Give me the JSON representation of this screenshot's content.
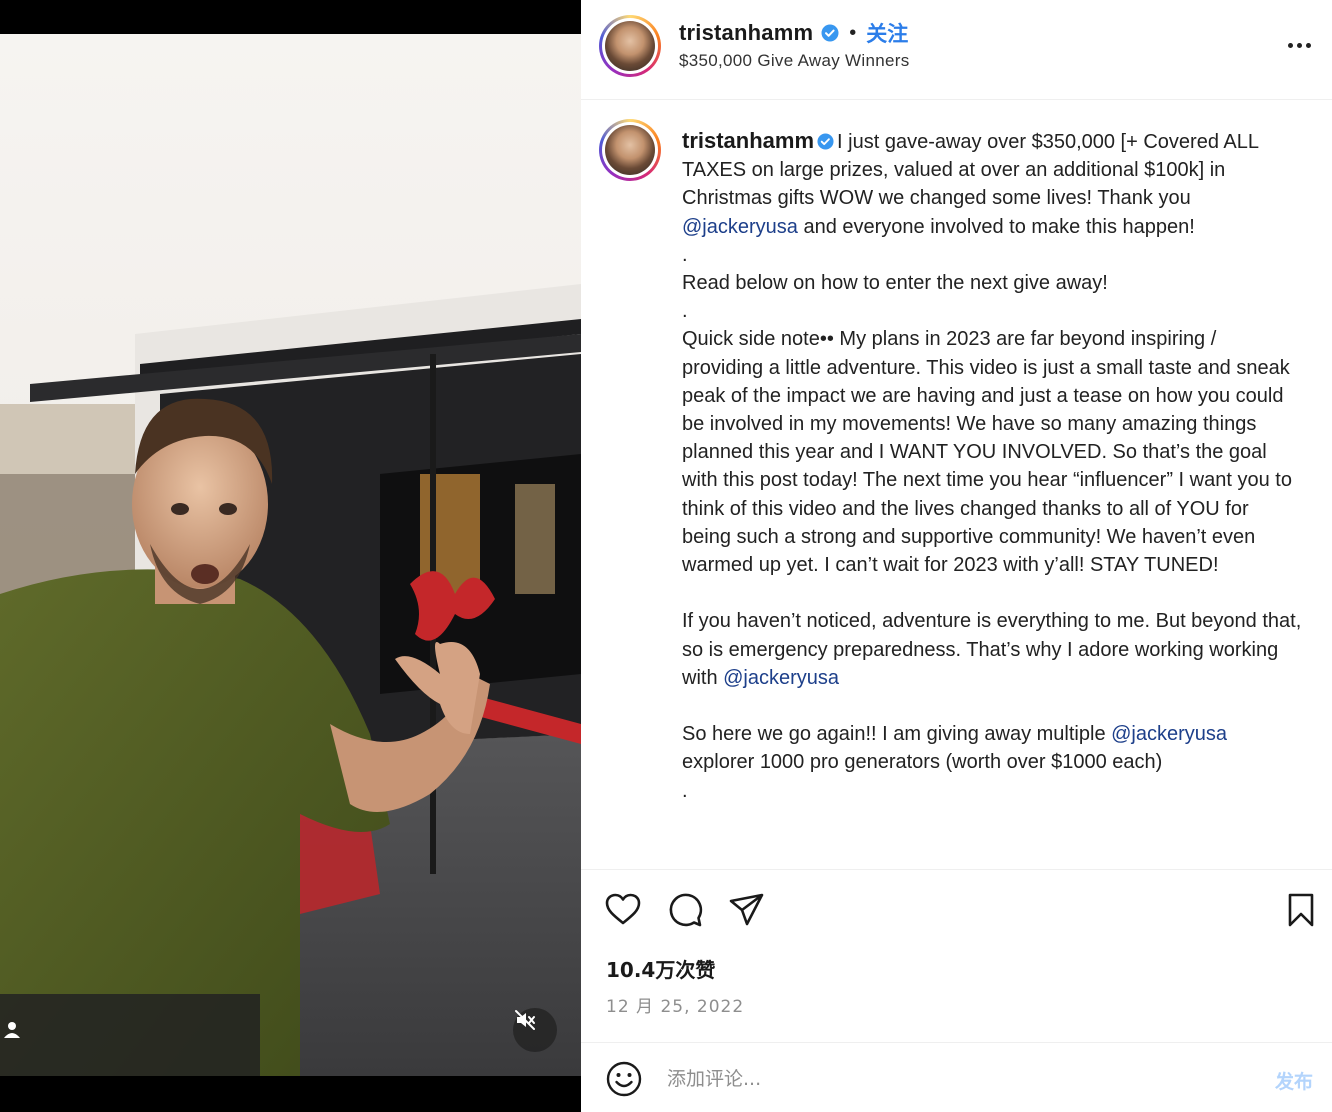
{
  "post": {
    "username": "tristanhamm",
    "follow_label": "关注",
    "separator": "•",
    "subtitle": "$350,000 Give Away Winners"
  },
  "caption": {
    "username": "tristanhamm",
    "p1_a": "I just gave-away over $350,000 [+ Covered ALL TAXES on large prizes, valued at over an additional $100k] in Christmas gifts WOW we changed some lives! Thank you ",
    "p1_mention": "@jackeryusa",
    "p1_b": " and everyone involved to make this happen!",
    "dot1": ".",
    "p2": "Read below on how to enter the next give away!",
    "dot2": ".",
    "p3": "Quick side note•• My plans in 2023 are far beyond inspiring / providing a little adventure. This video is just a small taste and sneak peak of the impact we are having and just a tease on how you could be involved in my movements! We have so many amazing things planned this year and I WANT YOU INVOLVED. So that’s the goal with this post today! The next time you hear “influencer” I want you to think of this video and the lives changed thanks to all of YOU for being such a strong and supportive community! We haven’t even warmed up yet. I can’t wait for 2023 with y’all! STAY TUNED!",
    "p4_a": "If you haven’t noticed, adventure is everything to me. But beyond that, so is emergency preparedness. That’s why I adore working working with ",
    "p4_mention": "@jackeryusa",
    "p5_a": "So here we go again!! I am giving away multiple ",
    "p5_mention": "@jackeryusa",
    "p5_b": " explorer 1000 pro generators (worth over $1000 each)",
    "dot3": "."
  },
  "stats": {
    "likes": "10.4万次赞",
    "date": "12 月 25, 2022"
  },
  "comment": {
    "placeholder": "添加评论...",
    "post_label": "发布"
  },
  "icons": {
    "verified": "verified-badge-icon",
    "more": "more-options-icon",
    "like": "heart-icon",
    "comment": "comment-icon",
    "share": "send-icon",
    "save": "bookmark-icon",
    "emoji": "emoji-icon",
    "user_tag": "user-tag-icon",
    "mute": "muted-speaker-icon"
  },
  "colors": {
    "verified": "#3897f0",
    "follow": "#2b7de9",
    "mention": "#1d3f8a",
    "post_button_disabled": "#b3d4fc"
  }
}
